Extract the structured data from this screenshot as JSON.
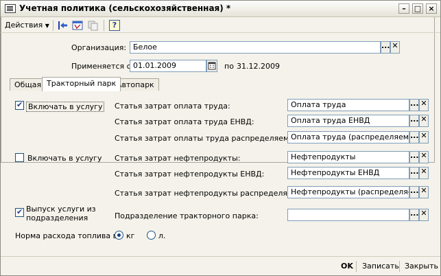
{
  "window": {
    "title": "Учетная политика (сельскохозяйственная) *",
    "controls": [
      "–",
      "□",
      "×"
    ]
  },
  "toolbar": {
    "actions_label": "Действия",
    "help_icon": "?"
  },
  "header": {
    "org_label": "Организация:",
    "org_value": "Белое",
    "applies_label": "Применяется с:",
    "date_from": "01.01.2009",
    "to_label": "по",
    "date_to": "31.12.2009"
  },
  "tabs": [
    "Общая",
    "Тракторный парк",
    "Автопарк"
  ],
  "active_tab": 1,
  "tractor": {
    "check1_label": "Включать в услугу",
    "check1_checked": true,
    "check2_label": "Включать в услугу",
    "check2_checked": false,
    "check3_label_line1": "Выпуск услуги из",
    "check3_label_line2": "подразделения",
    "check3_checked": true,
    "rows": [
      {
        "label": "Статья затрат оплата труда:",
        "value": "Оплата труда"
      },
      {
        "label": "Статья затрат оплата труда ЕНВД:",
        "value": "Оплата труда ЕНВД"
      },
      {
        "label": "Статья затрат оплаты труда распределяемая:",
        "value": "Оплата труда (распределяемая)"
      },
      {
        "label": "Статья затрат нефтепродукты:",
        "value": "Нефтепродукты"
      },
      {
        "label": "Статья затрат нефтепродукты ЕНВД:",
        "value": "Нефтепродукты ЕНВД"
      },
      {
        "label": "Статья затрат нефтепродукты распределяемая:",
        "value": "Нефтепродукты (распределяемые)"
      },
      {
        "label": "Подразделение тракторного парка:",
        "value": ""
      }
    ],
    "fuel_label": "Норма расхода топлива в:",
    "fuel_options": [
      "кг",
      "л."
    ],
    "fuel_selected": "кг"
  },
  "footer": {
    "ok": "OK",
    "save": "Записать",
    "close": "Закрыть"
  }
}
